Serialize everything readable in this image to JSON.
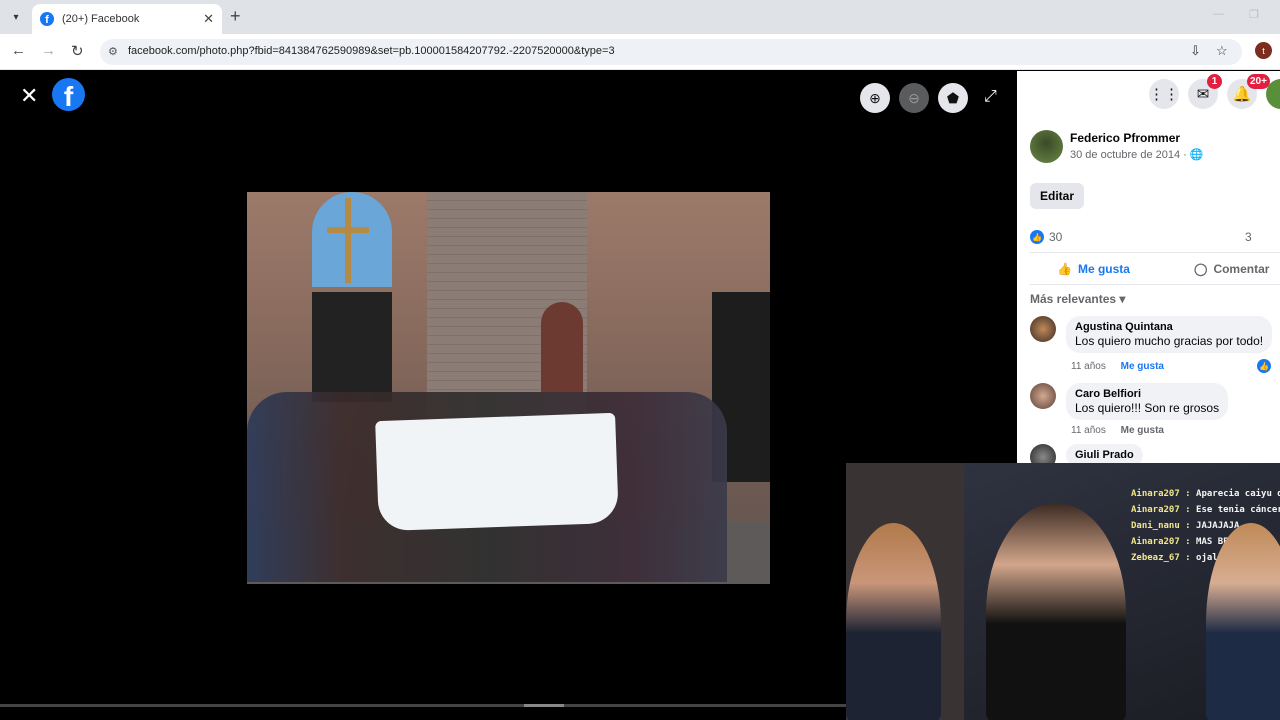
{
  "browser": {
    "tab_title": "(20+) Facebook",
    "tab_close": "✕",
    "new_tab": "+",
    "url": "facebook.com/photo.php?fbid=841384762590989&set=pb.100001584207792.-2207520000&type=3",
    "profile_initial": "t"
  },
  "viewer": {
    "close_symbol": "✕",
    "logo_letter": "f",
    "zoom_in_symbol": "⊕",
    "zoom_out_symbol": "⊖",
    "tag_symbol": "⬟",
    "expand_symbol": "⤢"
  },
  "header_icons": {
    "messenger_badge": "1",
    "notifications_badge": "20+"
  },
  "post": {
    "author": "Federico Pfrommer",
    "date": "30 de octubre de 2014 · 🌐",
    "edit_label": "Editar",
    "like_count": "30",
    "comment_count": "3",
    "like_label": "Me gusta",
    "comment_label": "Comentar",
    "sort_label": "Más relevantes ▾"
  },
  "comments": [
    {
      "name": "Agustina Quintana",
      "text": "Los quiero mucho gracias por todo!",
      "age": "11 años",
      "like": "Me gusta"
    },
    {
      "name": "Caro Belfiori",
      "text": "Los quiero!!! Son re grosos",
      "age": "11 años",
      "like": "Me gusta"
    },
    {
      "name": "Giuli Prado",
      "text": "",
      "age": "",
      "like": ""
    }
  ],
  "stream_chat": [
    {
      "user": "Ainara207 :",
      "msg": "Aparecia caiyu de la r"
    },
    {
      "user": "Ainara207 :",
      "msg": "Ese tenia cáncer crec"
    },
    {
      "user": "Dani_nanu :",
      "msg": "JAJAJAJA"
    },
    {
      "user": "Ainara207 :",
      "msg": "MAS BE"
    },
    {
      "user": "Zebeaz_67 :",
      "msg": "ojalá"
    }
  ],
  "colors": {
    "facebook_blue": "#1877f2",
    "badge_red": "#e41e3f",
    "chat_user": "#f0e68c"
  }
}
